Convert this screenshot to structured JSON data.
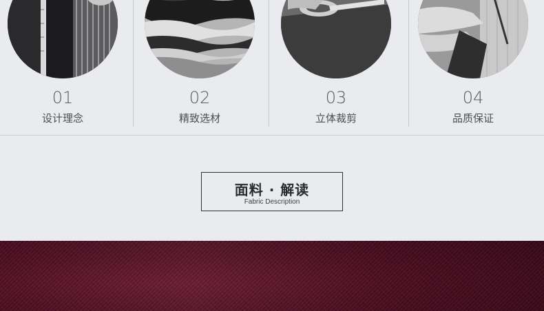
{
  "features": [
    {
      "number": "01",
      "label": "设计理念",
      "image": "tailor-measuring-photo"
    },
    {
      "number": "02",
      "label": "精致选材",
      "image": "fabric-layers-photo"
    },
    {
      "number": "03",
      "label": "立体裁剪",
      "image": "scissors-cutting-photo"
    },
    {
      "number": "04",
      "label": "品质保证",
      "image": "sewing-hands-photo"
    }
  ],
  "section": {
    "title": "面料 · 解读",
    "subtitle": "Fabric Description"
  },
  "colors": {
    "background": "#eaebef",
    "fabric": "#5a1027",
    "text": "#4a4d52"
  }
}
